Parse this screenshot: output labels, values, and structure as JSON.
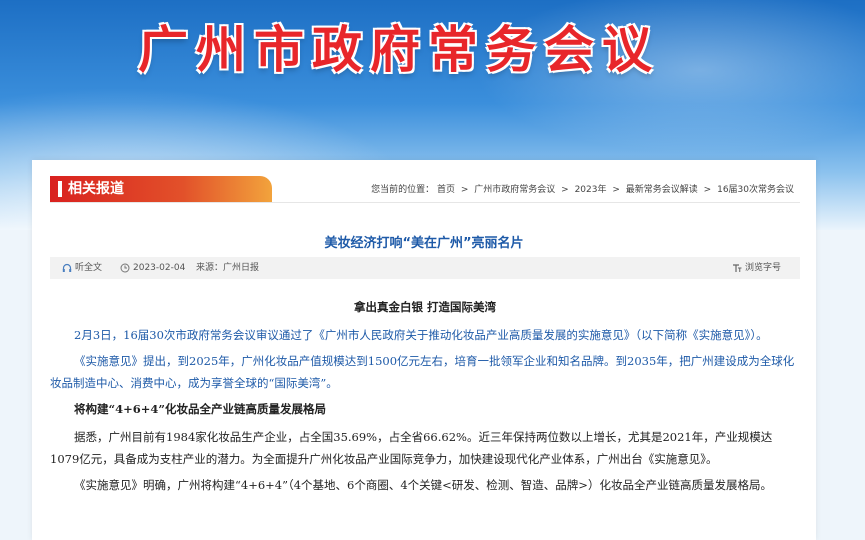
{
  "banner": {
    "title": "广州市政府常务会议"
  },
  "section": {
    "label": "相关报道"
  },
  "breadcrumb": {
    "prefix": "您当前的位置：",
    "items": [
      "首页",
      "广州市政府常务会议",
      "2023年",
      "最新常务会议解读",
      "16届30次常务会议"
    ],
    "sep": ">"
  },
  "article": {
    "title": "美妆经济打响“美在广州”亮丽名片",
    "listen_label": "听全文",
    "date": "2023-02-04",
    "source": "来源：广州日报",
    "font_size_label": "浏览字号",
    "subtitle": "拿出真金白银  打造国际美湾",
    "paragraphs": [
      "2月3日，16届30次市政府常务会议审议通过了《广州市人民政府关于推动化妆品产业高质量发展的实施意见》（以下简称《实施意见》）。",
      "《实施意见》提出，到2025年，广州化妆品产值规模达到1500亿元左右，培育一批领军企业和知名品牌。到2035年，把广州建设成为全球化妆品制造中心、消费中心，成为享誉全球的“国际美湾”。"
    ],
    "heading": "将构建“4+6+4”化妆品全产业链高质量发展格局",
    "paragraphs2": [
      "据悉，广州目前有1984家化妆品生产企业，占全国35.69%，占全省66.62%。近三年保持两位数以上增长，尤其是2021年，产业规模达1079亿元，具备成为支柱产业的潜力。为全面提升广州化妆品产业国际竞争力，加快建设现代化产业体系，广州出台《实施意见》。",
      "《实施意见》明确，广州将构建“4+6+4”（4个基地、6个商圈、4个关键<研发、检测、智造、品牌>）化妆品全产业链高质量发展格局。"
    ]
  },
  "colors": {
    "title_red": "#e8262a",
    "link_blue": "#1e5aa8",
    "tag_red": "#d9211f"
  }
}
